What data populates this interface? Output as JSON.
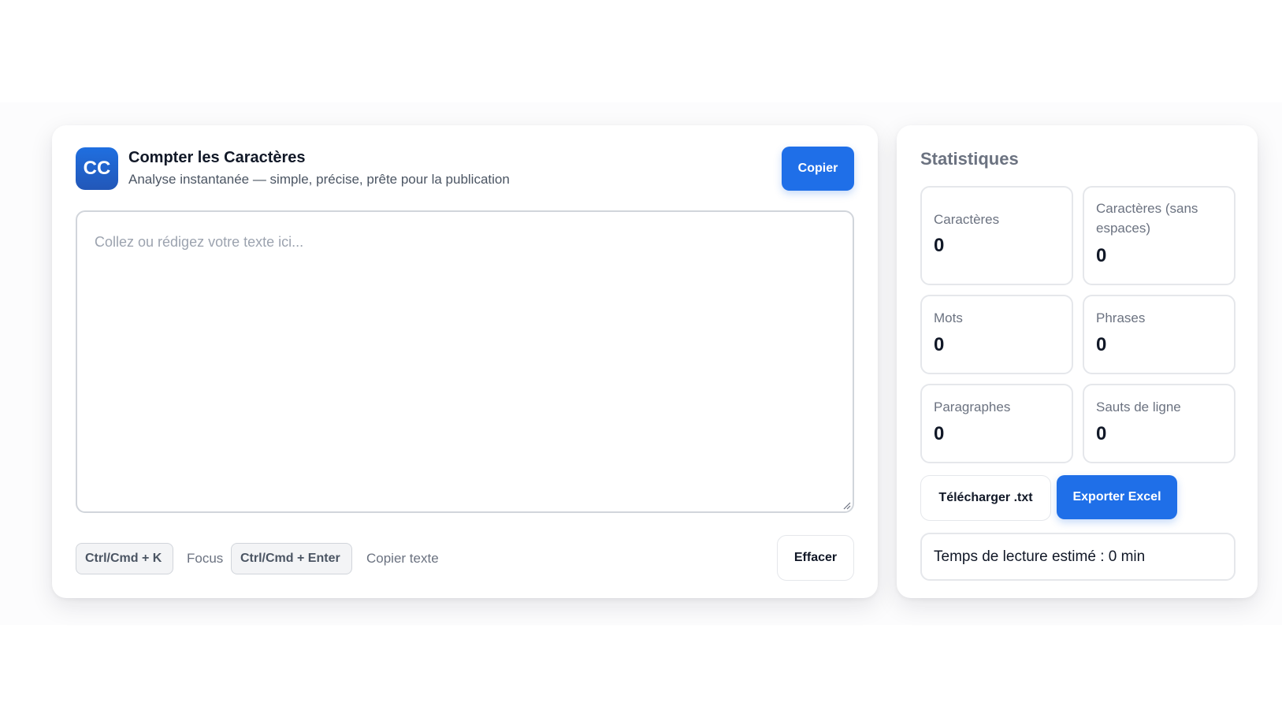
{
  "app": {
    "logo_text": "CC",
    "title": "Compter les Caractères",
    "subtitle": "Analyse instantanée — simple, précise, prête pour la publication",
    "copy_label": "Copier"
  },
  "editor": {
    "placeholder": "Collez ou rédigez votre texte ici...",
    "value": ""
  },
  "shortcuts": [
    {
      "keys": "Ctrl/Cmd + K",
      "action": "Focus"
    },
    {
      "keys": "Ctrl/Cmd + Enter",
      "action": "Copier texte"
    }
  ],
  "clear_label": "Effacer",
  "stats": {
    "title": "Statistiques",
    "items": [
      {
        "label": "Caractères",
        "value": "0"
      },
      {
        "label": "Caractères (sans espaces)",
        "value": "0"
      },
      {
        "label": "Mots",
        "value": "0"
      },
      {
        "label": "Phrases",
        "value": "0"
      },
      {
        "label": "Paragraphes",
        "value": "0"
      },
      {
        "label": "Sauts de ligne",
        "value": "0"
      }
    ],
    "download_label": "Télécharger .txt",
    "export_label": "Exporter Excel",
    "reading_time": "Temps de lecture estimé : 0 min"
  },
  "colors": {
    "accent": "#1f6fe8",
    "muted_text": "#6b7280",
    "border": "#e5e7eb"
  }
}
